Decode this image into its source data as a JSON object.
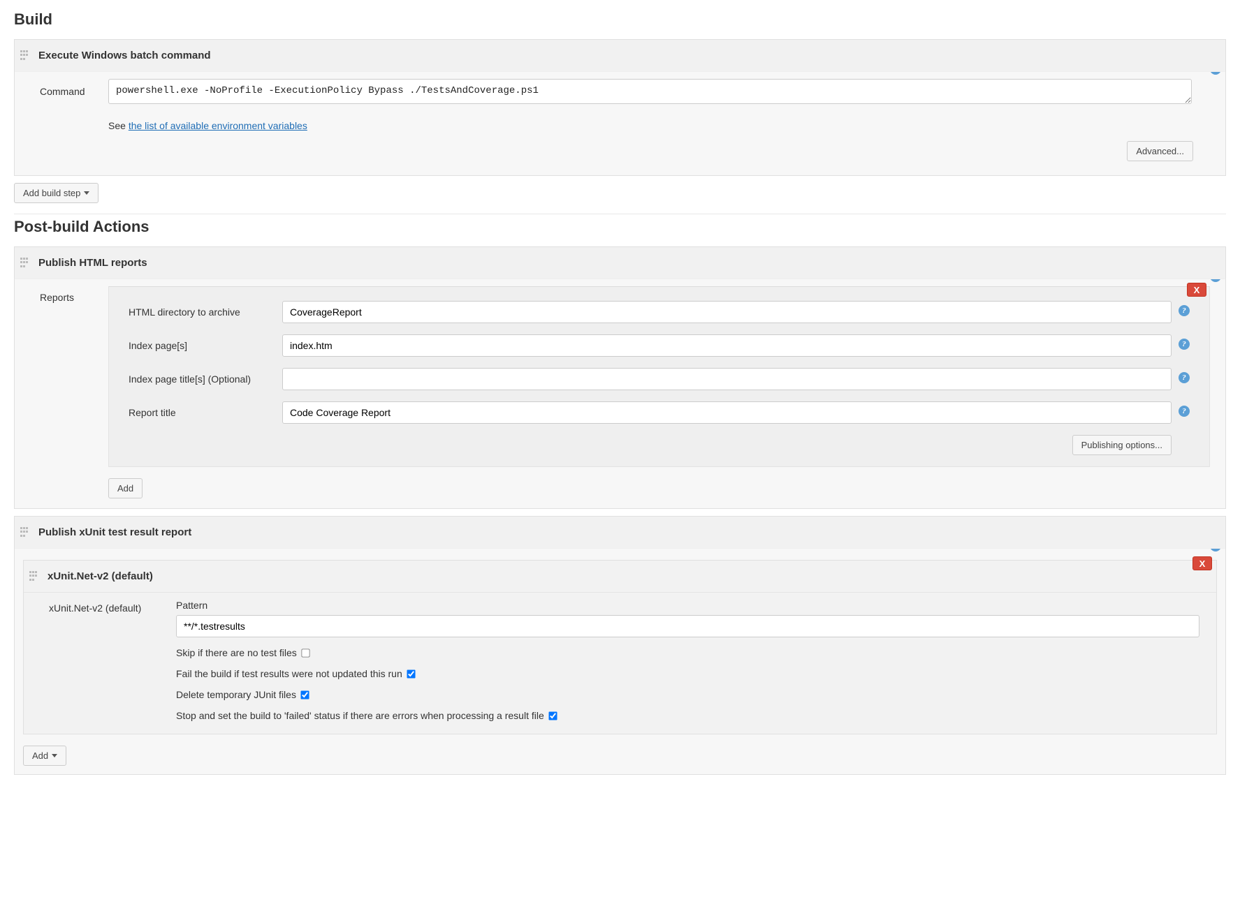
{
  "build": {
    "title": "Build",
    "execBatch": {
      "header": "Execute Windows batch command",
      "commandLabel": "Command",
      "commandValue": "powershell.exe -NoProfile -ExecutionPolicy Bypass ./TestsAndCoverage.ps1",
      "hintPrefix": "See ",
      "hintLink": "the list of available environment variables",
      "advanced": "Advanced..."
    },
    "addStep": "Add build step"
  },
  "post": {
    "title": "Post-build Actions",
    "publishHtml": {
      "header": "Publish HTML reports",
      "reportsLabel": "Reports",
      "fields": {
        "htmlDirLabel": "HTML directory to archive",
        "htmlDir": "CoverageReport",
        "indexLabel": "Index page[s]",
        "index": "index.htm",
        "titleLabel": "Index page title[s] (Optional)",
        "title": "",
        "reportTitleLabel": "Report title",
        "reportTitle": "Code Coverage Report"
      },
      "pubOptions": "Publishing options...",
      "add": "Add"
    },
    "publishXunit": {
      "header": "Publish xUnit test result report",
      "subHeader": "xUnit.Net-v2 (default)",
      "leftLabel": "xUnit.Net-v2 (default)",
      "patternLabel": "Pattern",
      "pattern": "**/*.testresults",
      "checks": {
        "skip": {
          "label": "Skip if there are no test files",
          "checked": false
        },
        "fail": {
          "label": "Fail the build if test results were not updated this run",
          "checked": true
        },
        "del": {
          "label": "Delete temporary JUnit files",
          "checked": true
        },
        "stop": {
          "label": "Stop and set the build to 'failed' status if there are errors when processing a result file",
          "checked": true
        }
      },
      "add": "Add"
    }
  },
  "x": "X"
}
